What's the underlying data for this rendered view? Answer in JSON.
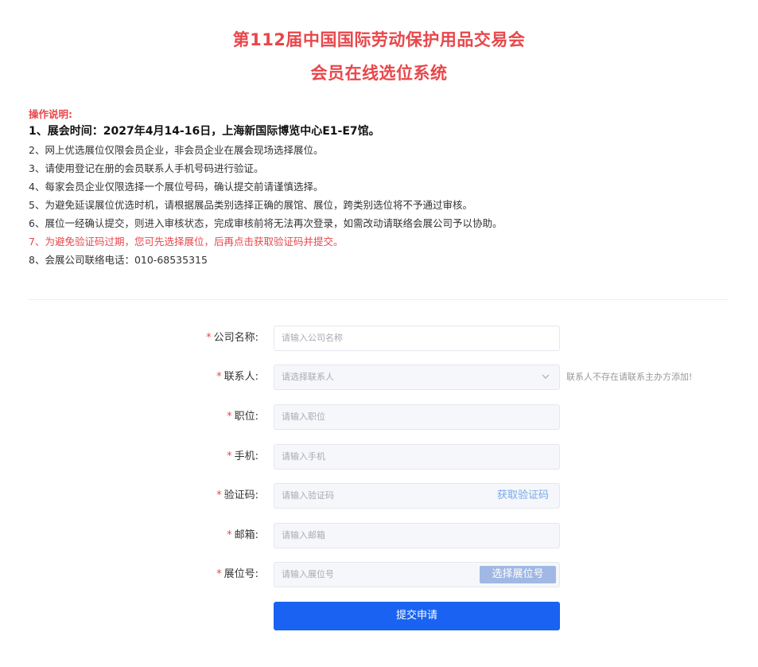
{
  "header": {
    "title_line1": "第112届中国国际劳动保护用品交易会",
    "title_line2": "会员在线选位系统"
  },
  "instructions": {
    "label": "操作说明:",
    "items": [
      "1、展会时间：2027年4月14-16日，上海新国际博览中心E1-E7馆。",
      "2、网上优选展位仅限会员企业，非会员企业在展会现场选择展位。",
      "3、请使用登记在册的会员联系人手机号码进行验证。",
      "4、每家会员企业仅限选择一个展位号码，确认提交前请谨慎选择。",
      "5、为避免延误展位优选时机，请根据展品类别选择正确的展馆、展位，跨类别选位将不予通过审核。",
      "6、展位一经确认提交，则进入审核状态，完成审核前将无法再次登录，如需改动请联络会展公司予以协助。",
      "7、为避免验证码过期，您可先选择展位，后再点击获取验证码并提交。",
      "8、会展公司联络电话：010-68535315"
    ]
  },
  "form": {
    "required_mark": "*",
    "company": {
      "label": "公司名称:",
      "placeholder": "请输入公司名称"
    },
    "contact": {
      "label": "联系人:",
      "placeholder": "请选择联系人",
      "note": "联系人不存在请联系主办方添加!"
    },
    "position": {
      "label": "职位:",
      "placeholder": "请输入职位"
    },
    "phone": {
      "label": "手机:",
      "placeholder": "请输入手机"
    },
    "code": {
      "label": "验证码:",
      "placeholder": "请输入验证码",
      "action": "获取验证码"
    },
    "email": {
      "label": "邮箱:",
      "placeholder": "请输入邮箱"
    },
    "booth": {
      "label": "展位号:",
      "placeholder": "请输入展位号",
      "action": "选择展位号"
    },
    "submit_label": "提交申请"
  },
  "colors": {
    "accent_red": "#e8474b",
    "primary_blue": "#1a63f2",
    "link_blue": "#79a8e8",
    "disabled_blue": "#a0b8e3"
  },
  "icons": {
    "dropdown": "chevron-down-icon"
  }
}
